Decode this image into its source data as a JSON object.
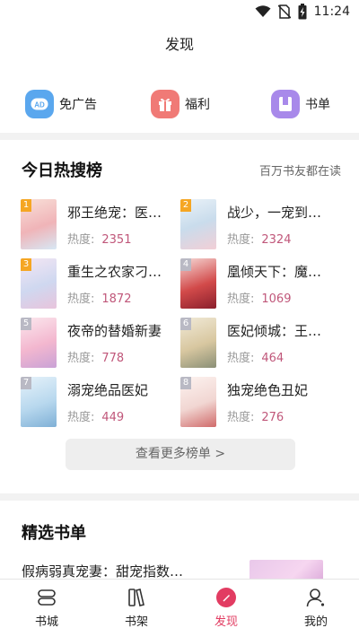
{
  "status_bar": {
    "time": "11:24"
  },
  "header": {
    "title": "发现"
  },
  "quick_links": [
    {
      "label": "免广告",
      "icon": "ad-icon",
      "color": "#5aa7ee"
    },
    {
      "label": "福利",
      "icon": "gift-icon",
      "color": "#f07a76"
    },
    {
      "label": "书单",
      "icon": "booklist-icon",
      "color": "#a889ea"
    }
  ],
  "hot": {
    "title": "今日热搜榜",
    "subtitle": "百万书友都在读",
    "heat_label": "热度:",
    "books": [
      {
        "rank": "1",
        "title": "邪王绝宠：医…",
        "heat": "2351"
      },
      {
        "rank": "2",
        "title": "战少，一宠到…",
        "heat": "2324"
      },
      {
        "rank": "3",
        "title": "重生之农家刁…",
        "heat": "1872"
      },
      {
        "rank": "4",
        "title": "凰倾天下：魔…",
        "heat": "1069"
      },
      {
        "rank": "5",
        "title": "夜帝的替婚新妻",
        "heat": "778"
      },
      {
        "rank": "6",
        "title": "医妃倾城：王…",
        "heat": "464"
      },
      {
        "rank": "7",
        "title": "溺宠绝品医妃",
        "heat": "449"
      },
      {
        "rank": "8",
        "title": "独宠绝色丑妃",
        "heat": "276"
      }
    ],
    "more_label": "查看更多榜单 >"
  },
  "picks": {
    "title": "精选书单",
    "first_title": "假病弱真宠妻：甜宠指数…"
  },
  "tabs": [
    {
      "label": "书城",
      "icon": "bookstore-icon"
    },
    {
      "label": "书架",
      "icon": "bookshelf-icon"
    },
    {
      "label": "发现",
      "icon": "discover-icon",
      "active": true
    },
    {
      "label": "我的",
      "icon": "profile-icon"
    }
  ],
  "colors": {
    "accent": "#e23c62",
    "heat": "#c0577a",
    "rank_top": "#f5a623",
    "rank_other": "#b9b9c4"
  }
}
